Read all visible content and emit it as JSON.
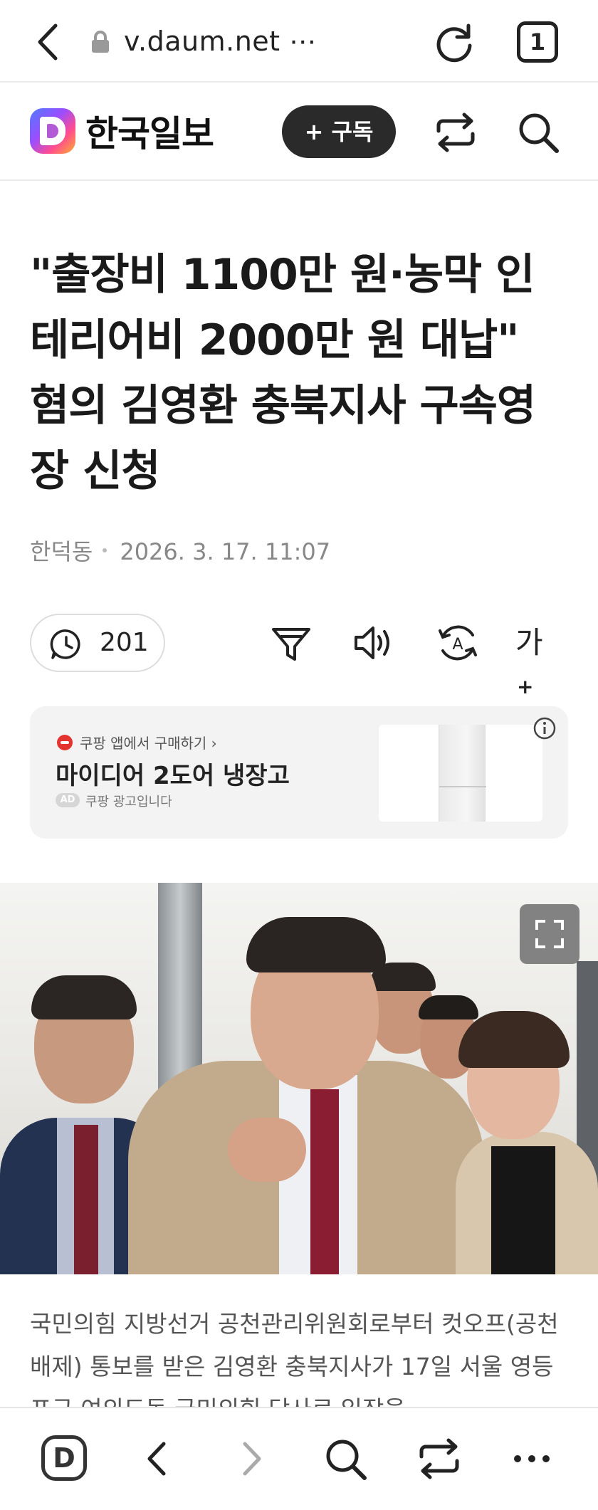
{
  "browser": {
    "url": "v.daum.net ⋯",
    "tab_count": "1"
  },
  "site": {
    "name": "한국일보",
    "subscribe_label": "+ 구독"
  },
  "article": {
    "headline": "\"출장비 1100만 원·농막 인테리어비 2000만 원 대납\" 혐의 김영환 충북지사 구속영장 신청",
    "author": "한덕동",
    "datetime": "2026. 3. 17. 11:07",
    "comment_count": "201",
    "font_tool_label": "가",
    "font_tool_plus": "+",
    "body_text": "국민의힘 지방선거 공천관리위원회로부터 컷오프(공천 배제) 통보를 받은 김영환 충북지사가 17일 서울 영등포구 여의도동 국민의힘 당사로 입장을"
  },
  "ad": {
    "promo": "쿠팡 앱에서 구매하기 ›",
    "product": "마이디어 2도어 냉장고",
    "badge": "AD",
    "note": "쿠팡 광고입니다"
  },
  "icons": {
    "back": "back-icon",
    "lock": "lock-icon",
    "reload": "reload-icon",
    "share": "share-icon",
    "search": "search-icon",
    "comment": "comment-icon",
    "filter": "filter-icon",
    "speaker": "speaker-icon",
    "translate": "translate-icon",
    "info": "info-icon",
    "expand": "expand-icon",
    "more": "more-icon"
  },
  "bottom_nav": {
    "daum_label": "D"
  },
  "colors": {
    "subscribe_bg": "#2a2a2a",
    "ad_bg": "#f3f3f3",
    "text_muted": "#888888"
  }
}
